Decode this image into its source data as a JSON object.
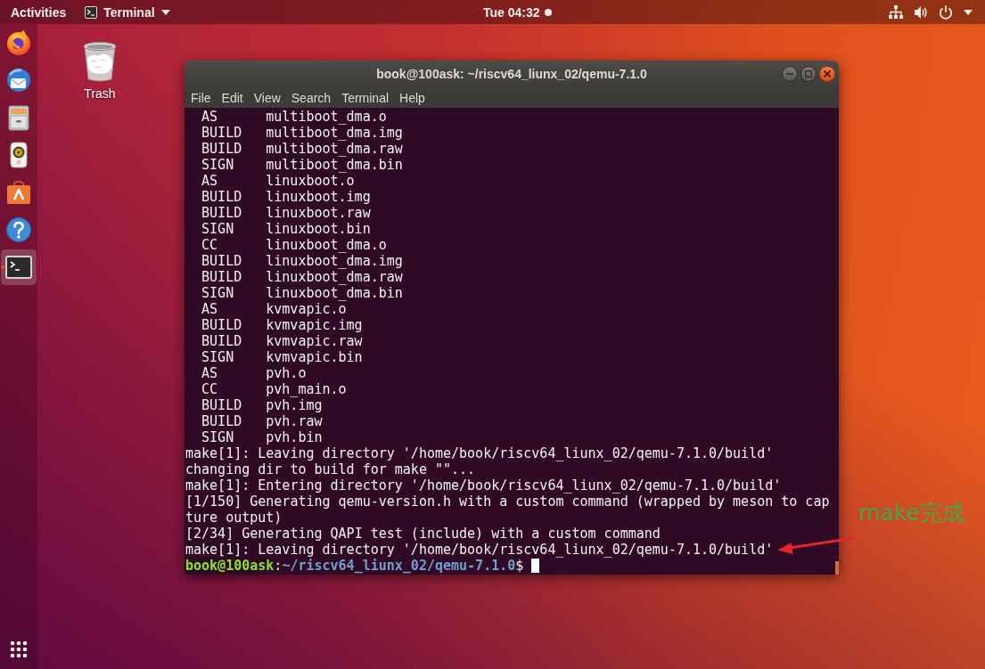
{
  "top_bar": {
    "activities": "Activities",
    "app_menu": "Terminal",
    "clock": "Tue 04:32",
    "notification": true
  },
  "dock": {
    "items": [
      {
        "selected": false
      },
      {
        "selected": false
      },
      {
        "selected": false
      },
      {
        "selected": false
      },
      {
        "selected": false
      },
      {
        "selected": false
      },
      {
        "selected": true
      }
    ]
  },
  "desktop_icons": [
    {
      "label": "Trash"
    }
  ],
  "terminal": {
    "title": "book@100ask: ~/riscv64_liunx_02/qemu-7.1.0",
    "menu": [
      "File",
      "Edit",
      "View",
      "Search",
      "Terminal",
      "Help"
    ],
    "lines": [
      {
        "kind": "step",
        "tag": "AS",
        "target": "multiboot_dma.o"
      },
      {
        "kind": "step",
        "tag": "BUILD",
        "target": "multiboot_dma.img"
      },
      {
        "kind": "step",
        "tag": "BUILD",
        "target": "multiboot_dma.raw"
      },
      {
        "kind": "step",
        "tag": "SIGN",
        "target": "multiboot_dma.bin"
      },
      {
        "kind": "step",
        "tag": "AS",
        "target": "linuxboot.o"
      },
      {
        "kind": "step",
        "tag": "BUILD",
        "target": "linuxboot.img"
      },
      {
        "kind": "step",
        "tag": "BUILD",
        "target": "linuxboot.raw"
      },
      {
        "kind": "step",
        "tag": "SIGN",
        "target": "linuxboot.bin"
      },
      {
        "kind": "step",
        "tag": "CC",
        "target": "linuxboot_dma.o"
      },
      {
        "kind": "step",
        "tag": "BUILD",
        "target": "linuxboot_dma.img"
      },
      {
        "kind": "step",
        "tag": "BUILD",
        "target": "linuxboot_dma.raw"
      },
      {
        "kind": "step",
        "tag": "SIGN",
        "target": "linuxboot_dma.bin"
      },
      {
        "kind": "step",
        "tag": "AS",
        "target": "kvmvapic.o"
      },
      {
        "kind": "step",
        "tag": "BUILD",
        "target": "kvmvapic.img"
      },
      {
        "kind": "step",
        "tag": "BUILD",
        "target": "kvmvapic.raw"
      },
      {
        "kind": "step",
        "tag": "SIGN",
        "target": "kvmvapic.bin"
      },
      {
        "kind": "step",
        "tag": "AS",
        "target": "pvh.o"
      },
      {
        "kind": "step",
        "tag": "CC",
        "target": "pvh_main.o"
      },
      {
        "kind": "step",
        "tag": "BUILD",
        "target": "pvh.img"
      },
      {
        "kind": "step",
        "tag": "BUILD",
        "target": "pvh.raw"
      },
      {
        "kind": "step",
        "tag": "SIGN",
        "target": "pvh.bin"
      },
      {
        "kind": "text",
        "text": "make[1]: Leaving directory '/home/book/riscv64_liunx_02/qemu-7.1.0/build'"
      },
      {
        "kind": "text",
        "text": "changing dir to build for make \"\"..."
      },
      {
        "kind": "text",
        "text": "make[1]: Entering directory '/home/book/riscv64_liunx_02/qemu-7.1.0/build'"
      },
      {
        "kind": "text",
        "text": "[1/150] Generating qemu-version.h with a custom command (wrapped by meson to capture output)"
      },
      {
        "kind": "text",
        "text": "[2/34] Generating QAPI test (include) with a custom command"
      },
      {
        "kind": "text",
        "text": "make[1]: Leaving directory '/home/book/riscv64_liunx_02/qemu-7.1.0/build'"
      }
    ],
    "prompt": {
      "user_host": "book@100ask",
      "separator": ":",
      "path": "~/riscv64_liunx_02/qemu-7.1.0",
      "symbol": "$"
    }
  },
  "annotation": {
    "text": "make完成"
  }
}
